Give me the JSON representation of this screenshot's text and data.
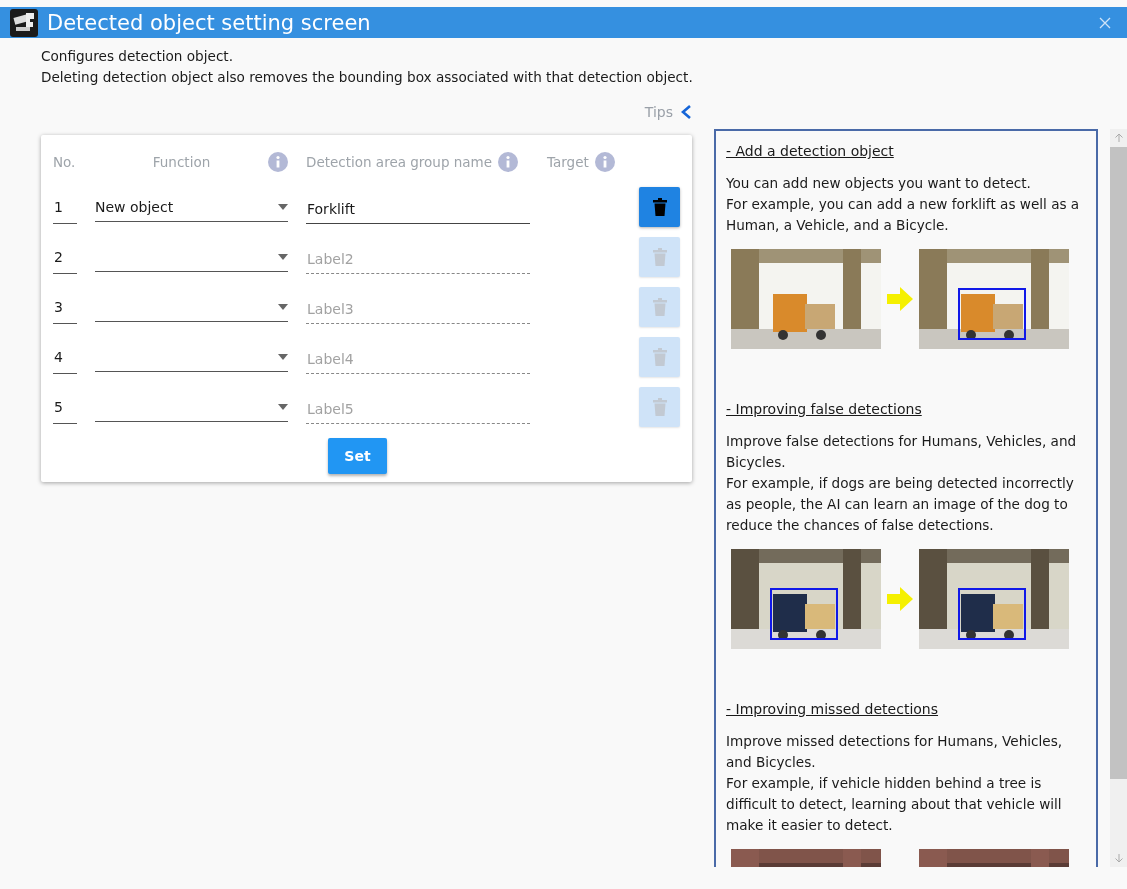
{
  "window": {
    "title": "Detected object setting screen"
  },
  "description": [
    "Configures detection object.",
    "Deleting detection object also removes the bounding box associated with that detection object."
  ],
  "tips_toggle": {
    "label": "Tips",
    "expanded": true
  },
  "table": {
    "columns": [
      {
        "label": "No.",
        "info": false
      },
      {
        "label": "Function",
        "info": true
      },
      {
        "label": "Detection area group name",
        "info": true
      },
      {
        "label": "Target",
        "info": true
      }
    ],
    "rows": [
      {
        "no": "1",
        "function": "New object",
        "name": "Forklift",
        "delete_disabled": false
      },
      {
        "no": "2",
        "function": "",
        "name_placeholder": "Label2",
        "delete_disabled": true
      },
      {
        "no": "3",
        "function": "",
        "name_placeholder": "Label3",
        "delete_disabled": true
      },
      {
        "no": "4",
        "function": "",
        "name_placeholder": "Label4",
        "delete_disabled": true
      },
      {
        "no": "5",
        "function": "",
        "name_placeholder": "Label5",
        "delete_disabled": true
      }
    ],
    "set_button": "Set"
  },
  "tips": [
    {
      "title": "- Add a detection object",
      "paragraphs": [
        "You can add new objects you want to detect.",
        "For example, you can add a new forklift as well as a Human, a Vehicle, and a Bicycle."
      ]
    },
    {
      "title": "- Improving false detections",
      "paragraphs": [
        "Improve false detections for Humans, Vehicles, and Bicycles.",
        "For example, if dogs are being detected incorrectly as people, the AI can learn an image of the dog to reduce the chances of false detections."
      ]
    },
    {
      "title": "- Improving missed detections",
      "paragraphs": [
        "Improve missed detections for Humans, Vehicles, and Bicycles.",
        "For example, if vehicle hidden behind a tree is difficult to detect, learning about that vehicle will make it easier to detect."
      ]
    }
  ]
}
